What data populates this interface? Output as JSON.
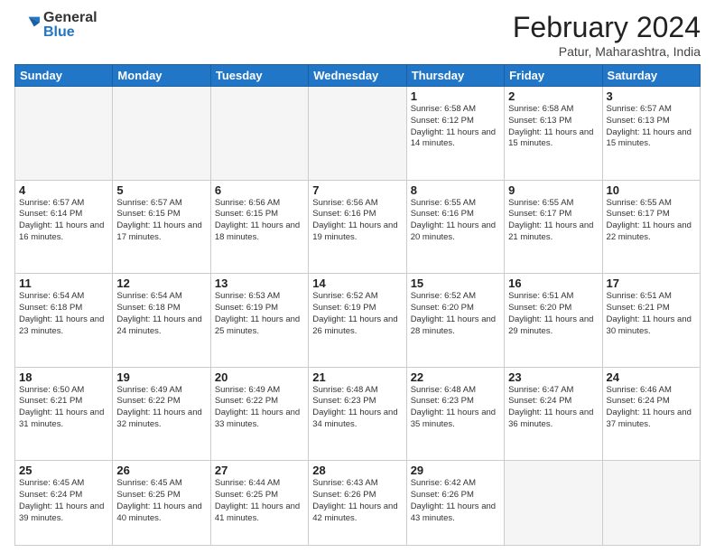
{
  "header": {
    "logo_general": "General",
    "logo_blue": "Blue",
    "month_year": "February 2024",
    "location": "Patur, Maharashtra, India"
  },
  "days_of_week": [
    "Sunday",
    "Monday",
    "Tuesday",
    "Wednesday",
    "Thursday",
    "Friday",
    "Saturday"
  ],
  "weeks": [
    [
      {
        "day": "",
        "info": ""
      },
      {
        "day": "",
        "info": ""
      },
      {
        "day": "",
        "info": ""
      },
      {
        "day": "",
        "info": ""
      },
      {
        "day": "1",
        "info": "Sunrise: 6:58 AM\nSunset: 6:12 PM\nDaylight: 11 hours and 14 minutes."
      },
      {
        "day": "2",
        "info": "Sunrise: 6:58 AM\nSunset: 6:13 PM\nDaylight: 11 hours and 15 minutes."
      },
      {
        "day": "3",
        "info": "Sunrise: 6:57 AM\nSunset: 6:13 PM\nDaylight: 11 hours and 15 minutes."
      }
    ],
    [
      {
        "day": "4",
        "info": "Sunrise: 6:57 AM\nSunset: 6:14 PM\nDaylight: 11 hours and 16 minutes."
      },
      {
        "day": "5",
        "info": "Sunrise: 6:57 AM\nSunset: 6:15 PM\nDaylight: 11 hours and 17 minutes."
      },
      {
        "day": "6",
        "info": "Sunrise: 6:56 AM\nSunset: 6:15 PM\nDaylight: 11 hours and 18 minutes."
      },
      {
        "day": "7",
        "info": "Sunrise: 6:56 AM\nSunset: 6:16 PM\nDaylight: 11 hours and 19 minutes."
      },
      {
        "day": "8",
        "info": "Sunrise: 6:55 AM\nSunset: 6:16 PM\nDaylight: 11 hours and 20 minutes."
      },
      {
        "day": "9",
        "info": "Sunrise: 6:55 AM\nSunset: 6:17 PM\nDaylight: 11 hours and 21 minutes."
      },
      {
        "day": "10",
        "info": "Sunrise: 6:55 AM\nSunset: 6:17 PM\nDaylight: 11 hours and 22 minutes."
      }
    ],
    [
      {
        "day": "11",
        "info": "Sunrise: 6:54 AM\nSunset: 6:18 PM\nDaylight: 11 hours and 23 minutes."
      },
      {
        "day": "12",
        "info": "Sunrise: 6:54 AM\nSunset: 6:18 PM\nDaylight: 11 hours and 24 minutes."
      },
      {
        "day": "13",
        "info": "Sunrise: 6:53 AM\nSunset: 6:19 PM\nDaylight: 11 hours and 25 minutes."
      },
      {
        "day": "14",
        "info": "Sunrise: 6:52 AM\nSunset: 6:19 PM\nDaylight: 11 hours and 26 minutes."
      },
      {
        "day": "15",
        "info": "Sunrise: 6:52 AM\nSunset: 6:20 PM\nDaylight: 11 hours and 28 minutes."
      },
      {
        "day": "16",
        "info": "Sunrise: 6:51 AM\nSunset: 6:20 PM\nDaylight: 11 hours and 29 minutes."
      },
      {
        "day": "17",
        "info": "Sunrise: 6:51 AM\nSunset: 6:21 PM\nDaylight: 11 hours and 30 minutes."
      }
    ],
    [
      {
        "day": "18",
        "info": "Sunrise: 6:50 AM\nSunset: 6:21 PM\nDaylight: 11 hours and 31 minutes."
      },
      {
        "day": "19",
        "info": "Sunrise: 6:49 AM\nSunset: 6:22 PM\nDaylight: 11 hours and 32 minutes."
      },
      {
        "day": "20",
        "info": "Sunrise: 6:49 AM\nSunset: 6:22 PM\nDaylight: 11 hours and 33 minutes."
      },
      {
        "day": "21",
        "info": "Sunrise: 6:48 AM\nSunset: 6:23 PM\nDaylight: 11 hours and 34 minutes."
      },
      {
        "day": "22",
        "info": "Sunrise: 6:48 AM\nSunset: 6:23 PM\nDaylight: 11 hours and 35 minutes."
      },
      {
        "day": "23",
        "info": "Sunrise: 6:47 AM\nSunset: 6:24 PM\nDaylight: 11 hours and 36 minutes."
      },
      {
        "day": "24",
        "info": "Sunrise: 6:46 AM\nSunset: 6:24 PM\nDaylight: 11 hours and 37 minutes."
      }
    ],
    [
      {
        "day": "25",
        "info": "Sunrise: 6:45 AM\nSunset: 6:24 PM\nDaylight: 11 hours and 39 minutes."
      },
      {
        "day": "26",
        "info": "Sunrise: 6:45 AM\nSunset: 6:25 PM\nDaylight: 11 hours and 40 minutes."
      },
      {
        "day": "27",
        "info": "Sunrise: 6:44 AM\nSunset: 6:25 PM\nDaylight: 11 hours and 41 minutes."
      },
      {
        "day": "28",
        "info": "Sunrise: 6:43 AM\nSunset: 6:26 PM\nDaylight: 11 hours and 42 minutes."
      },
      {
        "day": "29",
        "info": "Sunrise: 6:42 AM\nSunset: 6:26 PM\nDaylight: 11 hours and 43 minutes."
      },
      {
        "day": "",
        "info": ""
      },
      {
        "day": "",
        "info": ""
      }
    ]
  ]
}
